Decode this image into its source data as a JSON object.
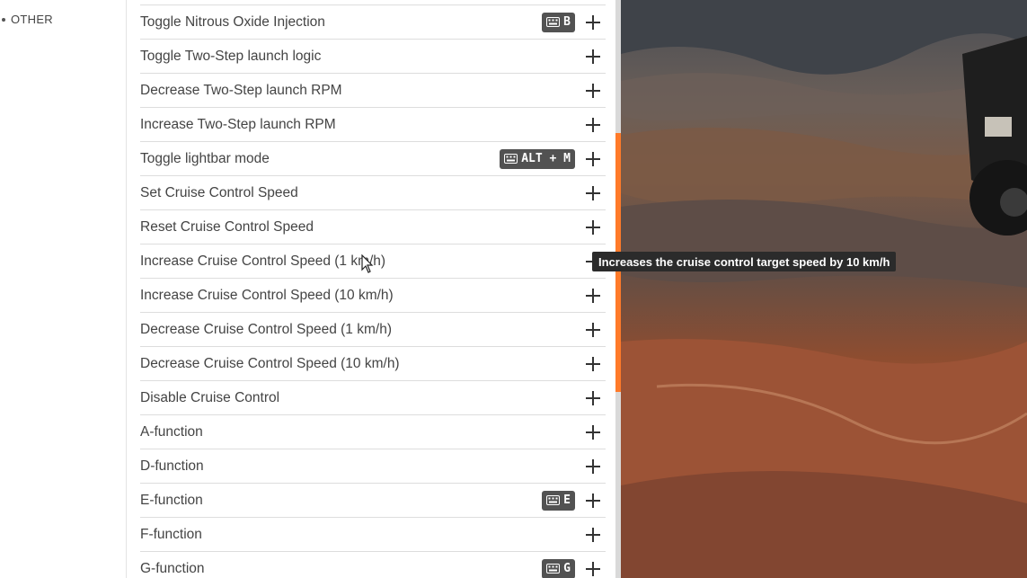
{
  "sidebar": {
    "items": [
      {
        "label": "OTHER"
      }
    ]
  },
  "bindings": [
    {
      "label": "Toggle Nitrous Oxide Injection",
      "key": "B"
    },
    {
      "label": "Toggle Two-Step launch logic",
      "key": ""
    },
    {
      "label": "Decrease Two-Step launch RPM",
      "key": ""
    },
    {
      "label": "Increase Two-Step launch RPM",
      "key": ""
    },
    {
      "label": "Toggle lightbar mode",
      "key": "ALT + M"
    },
    {
      "label": "Set Cruise Control Speed",
      "key": ""
    },
    {
      "label": "Reset Cruise Control Speed",
      "key": ""
    },
    {
      "label": "Increase Cruise Control Speed (1 km/h)",
      "key": ""
    },
    {
      "label": "Increase Cruise Control Speed (10 km/h)",
      "key": ""
    },
    {
      "label": "Decrease Cruise Control Speed (1 km/h)",
      "key": ""
    },
    {
      "label": "Decrease Cruise Control Speed (10 km/h)",
      "key": ""
    },
    {
      "label": "Disable Cruise Control",
      "key": ""
    },
    {
      "label": "A-function",
      "key": ""
    },
    {
      "label": "D-function",
      "key": ""
    },
    {
      "label": "E-function",
      "key": "E"
    },
    {
      "label": "F-function",
      "key": ""
    },
    {
      "label": "G-function",
      "key": "G"
    }
  ],
  "tooltip": {
    "text": "Increases the cruise control target speed by 10 km/h"
  },
  "icons": {
    "add": "plus-icon",
    "keyboard": "keyboard-icon"
  },
  "colors": {
    "accent": "#ff7a29",
    "binding_bg": "#525252"
  }
}
